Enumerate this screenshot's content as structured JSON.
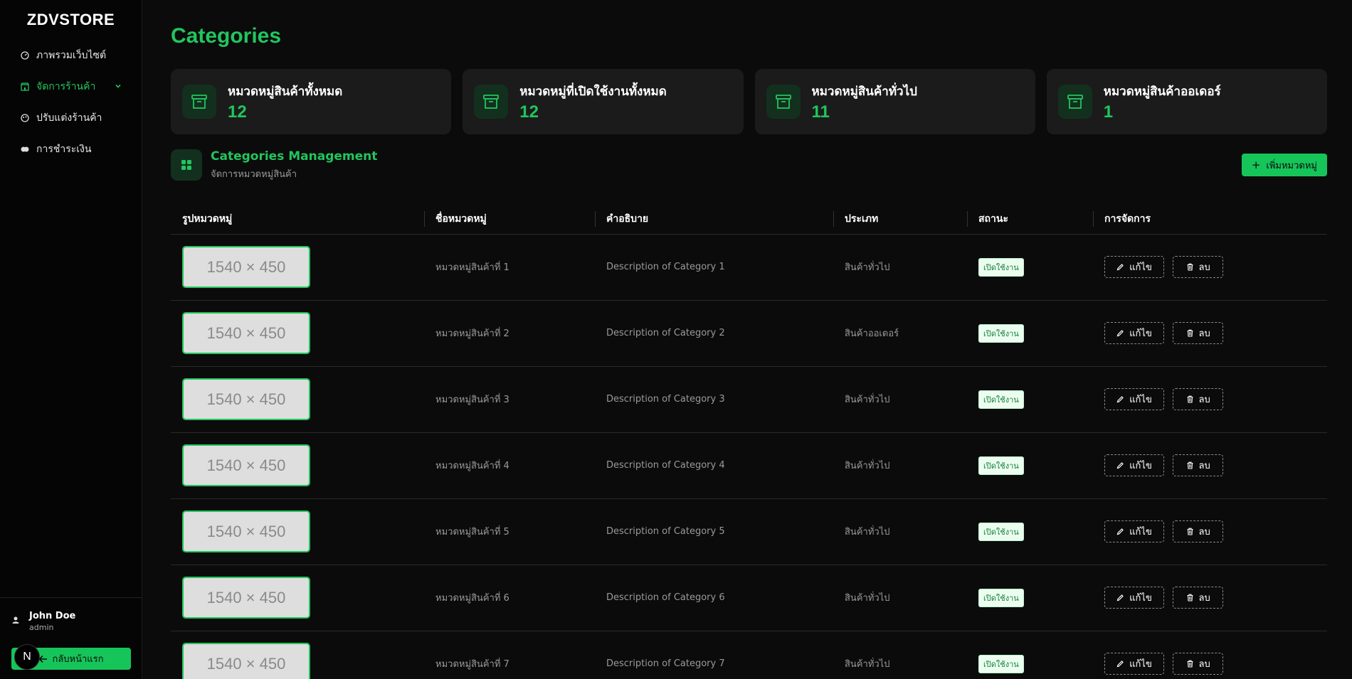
{
  "app": {
    "brand": "ZDVSTORE"
  },
  "sidebar": {
    "items": [
      {
        "label": "ภาพรวมเว็บไซต์",
        "icon": "dashboard-icon"
      },
      {
        "label": "จัดการร้านค้า",
        "icon": "store-icon",
        "active": true
      },
      {
        "label": "ปรับแต่งร้านค้า",
        "icon": "palette-icon"
      },
      {
        "label": "การชำระเงิน",
        "icon": "payment-icon"
      }
    ],
    "user": {
      "name": "John Doe",
      "role": "admin"
    },
    "home_button": "กลับหน้าแรก",
    "badge_letter": "N"
  },
  "page": {
    "title": "Categories"
  },
  "stats": [
    {
      "label": "หมวดหมู่สินค้าทั้งหมด",
      "value": "12"
    },
    {
      "label": "หมวดหมู่ที่เปิดใช้งานทั้งหมด",
      "value": "12"
    },
    {
      "label": "หมวดหมู่สินค้าทั่วไป",
      "value": "11"
    },
    {
      "label": "หมวดหมู่สินค้าออเดอร์",
      "value": "1"
    }
  ],
  "management": {
    "title": "Categories Management",
    "subtitle": "จัดการหมวดหมู่สินค้า",
    "add_button": "เพิ่มหมวดหมู่"
  },
  "table": {
    "headers": [
      "รูปหมวดหมู่",
      "ชื่อหมวดหมู่",
      "คำอธิบาย",
      "ประเภท",
      "สถานะ",
      "การจัดการ"
    ],
    "edit_label": "แก้ไข",
    "delete_label": "ลบ",
    "rows": [
      {
        "image": "1540 × 450",
        "name": "หมวดหมู่สินค้าที่ 1",
        "description": "Description of Category 1",
        "type": "สินค้าทั่วไป",
        "status": "เปิดใช้งาน"
      },
      {
        "image": "1540 × 450",
        "name": "หมวดหมู่สินค้าที่ 2",
        "description": "Description of Category 2",
        "type": "สินค้าออเดอร์",
        "status": "เปิดใช้งาน"
      },
      {
        "image": "1540 × 450",
        "name": "หมวดหมู่สินค้าที่ 3",
        "description": "Description of Category 3",
        "type": "สินค้าทั่วไป",
        "status": "เปิดใช้งาน"
      },
      {
        "image": "1540 × 450",
        "name": "หมวดหมู่สินค้าที่ 4",
        "description": "Description of Category 4",
        "type": "สินค้าทั่วไป",
        "status": "เปิดใช้งาน"
      },
      {
        "image": "1540 × 450",
        "name": "หมวดหมู่สินค้าที่ 5",
        "description": "Description of Category 5",
        "type": "สินค้าทั่วไป",
        "status": "เปิดใช้งาน"
      },
      {
        "image": "1540 × 450",
        "name": "หมวดหมู่สินค้าที่ 6",
        "description": "Description of Category 6",
        "type": "สินค้าทั่วไป",
        "status": "เปิดใช้งาน"
      },
      {
        "image": "1540 × 450",
        "name": "หมวดหมู่สินค้าที่ 7",
        "description": "Description of Category 7",
        "type": "สินค้าทั่วไป",
        "status": "เปิดใช้งาน"
      }
    ]
  },
  "colors": {
    "accent": "#22c55e",
    "background": "#0b0b0b",
    "card": "#1b1b1b"
  }
}
